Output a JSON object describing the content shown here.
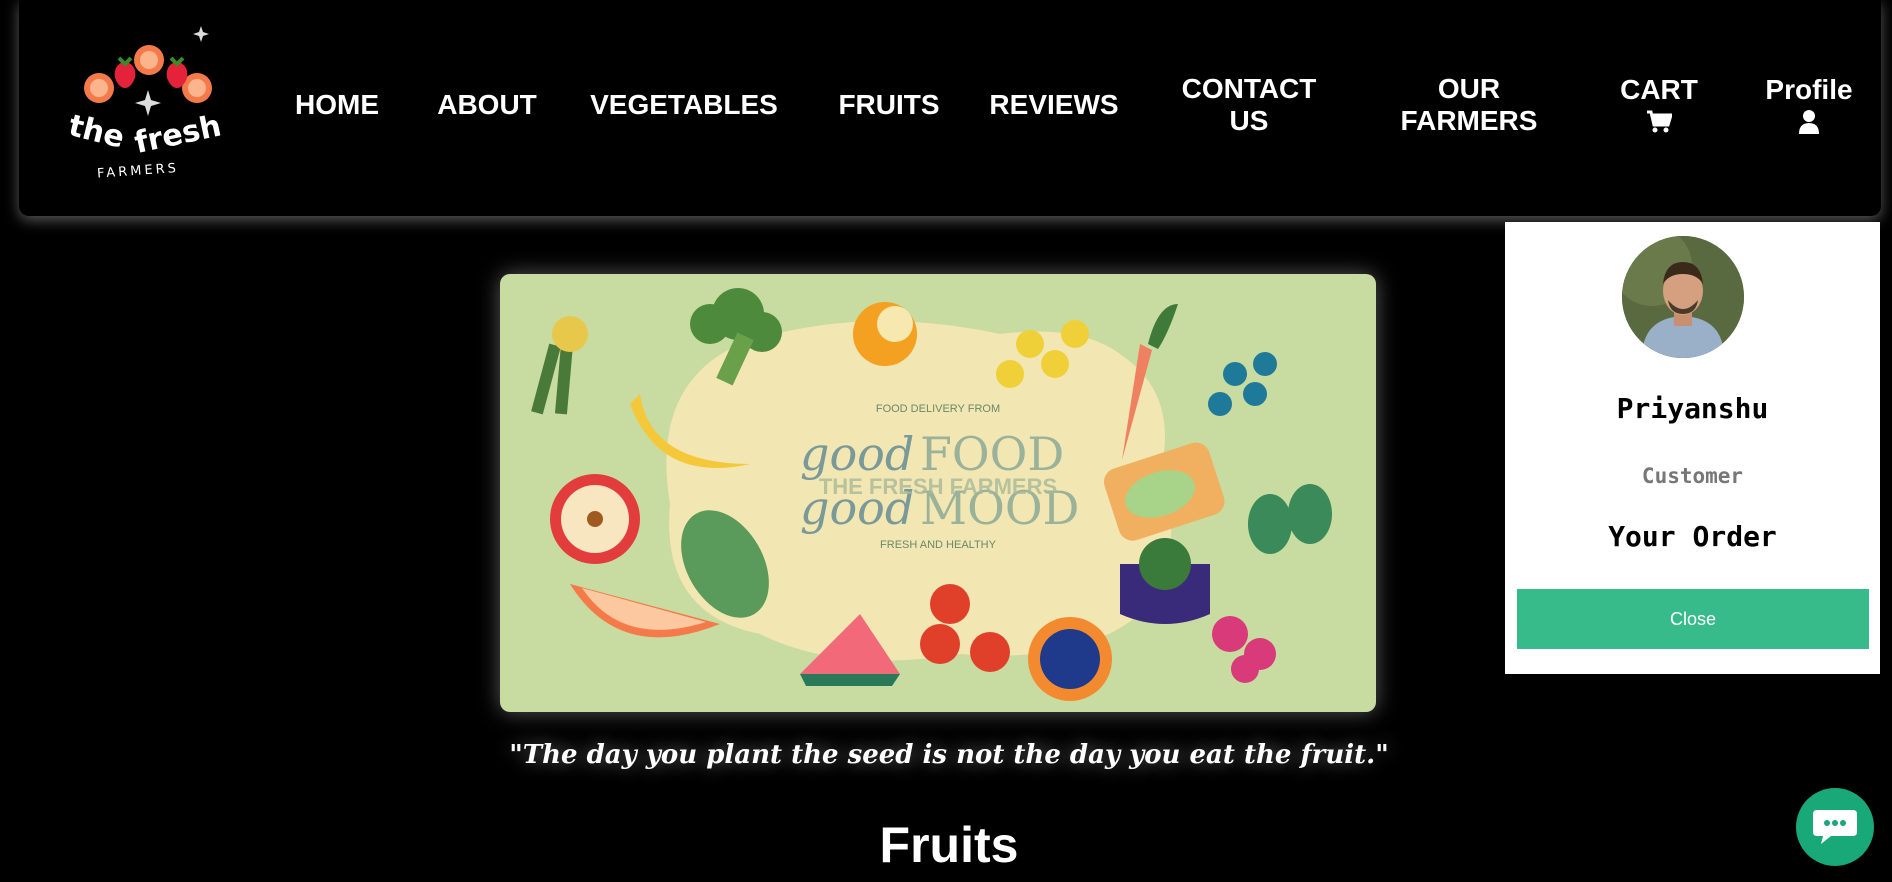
{
  "nav": {
    "brand_logo_text": "the fresh FARMERS",
    "items": [
      {
        "label_line1": "HOME",
        "label_line2": ""
      },
      {
        "label_line1": "ABOUT",
        "label_line2": ""
      },
      {
        "label_line1": "VEGETABLES",
        "label_line2": ""
      },
      {
        "label_line1": "FRUITS",
        "label_line2": ""
      },
      {
        "label_line1": "REVIEWS",
        "label_line2": ""
      },
      {
        "label_line1": "CONTACT",
        "label_line2": "US"
      },
      {
        "label_line1": "OUR",
        "label_line2": "FARMERS"
      },
      {
        "label_line1": "CART",
        "icon": "cart-icon"
      },
      {
        "label_line1": "Profile",
        "icon": "user-icon"
      }
    ]
  },
  "banner": {
    "small_top": "FOOD DELIVERY FROM",
    "script_line1": "good",
    "script_line2": "good",
    "big_line1": "FOOD",
    "big_line2": "MOOD",
    "brand_overlay": "THE FRESH FARMERS",
    "small_bottom": "FRESH AND HEALTHY"
  },
  "quote": "\"The day you plant the seed is not the day you eat the fruit.\"",
  "section_title": "Fruits",
  "profile": {
    "name": "Priyanshu",
    "role": "Customer",
    "orders_heading": "Your Order",
    "close_label": "Close"
  },
  "colors": {
    "accent_green": "#38bb8a",
    "chat_green": "#19a878",
    "banner_bg": "#c8dba0"
  },
  "chat": {
    "icon": "chat-icon"
  }
}
